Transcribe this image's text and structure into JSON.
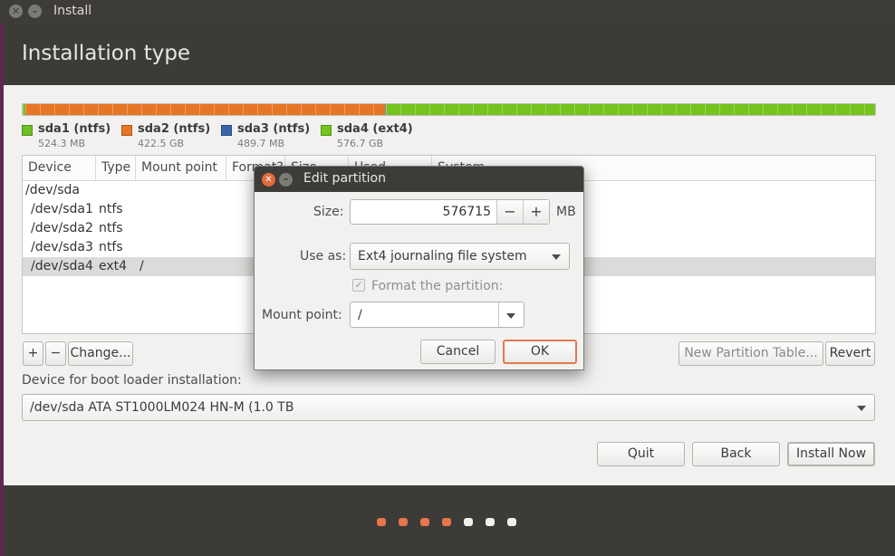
{
  "window": {
    "title": "Install",
    "close_glyph": "✕",
    "minimize_glyph": "–"
  },
  "page": {
    "title": "Installation type"
  },
  "partitions": [
    {
      "name": "sda1 (ntfs)",
      "size": "524.3 MB",
      "color": "#6bc026",
      "fraction": 0.0003
    },
    {
      "name": "sda2 (ntfs)",
      "size": "422.5 GB",
      "color": "#e77624",
      "fraction": 0.4224
    },
    {
      "name": "sda3 (ntfs)",
      "size": "489.7 MB",
      "color": "#3a65a8",
      "fraction": 0.0005
    },
    {
      "name": "sda4 (ext4)",
      "size": "576.7 GB",
      "color": "#75c41d",
      "fraction": 0.5768
    }
  ],
  "table": {
    "headers": [
      "Device",
      "Type",
      "Mount point",
      "Format?",
      "Size",
      "Used",
      "System"
    ],
    "rows": [
      {
        "device": "/dev/sda",
        "type": "",
        "mount": ""
      },
      {
        "device": "/dev/sda1",
        "type": "ntfs",
        "mount": ""
      },
      {
        "device": "/dev/sda2",
        "type": "ntfs",
        "mount": ""
      },
      {
        "device": "/dev/sda3",
        "type": "ntfs",
        "mount": ""
      },
      {
        "device": "/dev/sda4",
        "type": "ext4",
        "mount": "/"
      }
    ]
  },
  "table_actions": {
    "add": "+",
    "remove": "−",
    "change": "Change...",
    "new_partition_table": "New Partition Table...",
    "revert": "Revert"
  },
  "bootloader": {
    "label": "Device for boot loader installation:",
    "value": "/dev/sda   ATA ST1000LM024 HN-M (1.0 TB"
  },
  "nav": {
    "quit": "Quit",
    "back": "Back",
    "install_now": "Install Now"
  },
  "progress": {
    "steps_done": 4,
    "steps_total": 7
  },
  "dialog": {
    "title": "Edit partition",
    "size_label": "Size:",
    "size_value": "576715",
    "size_unit": "MB",
    "minus": "−",
    "plus": "+",
    "use_as_label": "Use as:",
    "use_as_value": "Ext4 journaling file system",
    "format_label": "Format the partition:",
    "format_checked": true,
    "mount_label": "Mount point:",
    "mount_value": "/",
    "cancel": "Cancel",
    "ok": "OK"
  },
  "colors": {
    "accent": "#e07a4f",
    "header_bg": "#3c3b37",
    "content_bg": "#f2f1f0"
  }
}
